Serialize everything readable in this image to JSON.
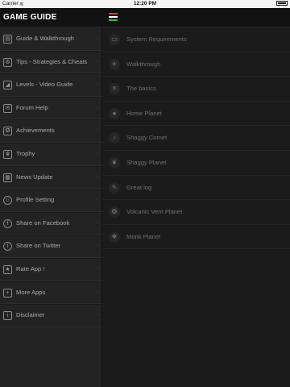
{
  "status_bar": {
    "carrier": "Carrier",
    "time": "12:20 PM"
  },
  "sidebar": {
    "title": "GAME GUIDE",
    "items": [
      {
        "label": "Guide & Walkthrough",
        "icon": "book-icon",
        "glyph": "▤"
      },
      {
        "label": "Tips - Strategies & Cheats",
        "icon": "chip-icon",
        "glyph": "⚙"
      },
      {
        "label": "Levels - Video Guide",
        "icon": "levels-icon",
        "glyph": "◢"
      },
      {
        "label": "Forum Help",
        "icon": "chat-icon",
        "glyph": "✉"
      },
      {
        "label": "Achievements",
        "icon": "medal-icon",
        "glyph": "✪"
      },
      {
        "label": "Trophy",
        "icon": "trophy-icon",
        "glyph": "♛"
      },
      {
        "label": "News Update",
        "icon": "news-icon",
        "glyph": "▦"
      },
      {
        "label": "Profile Setting",
        "icon": "user-icon",
        "glyph": "☺"
      },
      {
        "label": "Share on Facebook",
        "icon": "facebook-icon",
        "glyph": "f"
      },
      {
        "label": "Share on Twitter",
        "icon": "twitter-icon",
        "glyph": "t"
      },
      {
        "label": "Rate App !",
        "icon": "star-icon",
        "glyph": "★"
      },
      {
        "label": "More Apps",
        "icon": "plus-icon",
        "glyph": "+"
      },
      {
        "label": "Disclaimer",
        "icon": "info-icon",
        "glyph": "i"
      }
    ]
  },
  "main": {
    "menu_colors": [
      "#d93a2b",
      "#ffffff",
      "#3bb34a"
    ],
    "items": [
      {
        "label": "System Requirements",
        "icon": "monitor-icon",
        "glyph": "▭"
      },
      {
        "label": "Walkthrough",
        "icon": "walker-icon",
        "glyph": "✈"
      },
      {
        "label": "The basics",
        "icon": "shuffle-icon",
        "glyph": "✕"
      },
      {
        "label": "Home Planet",
        "icon": "planet-icon",
        "glyph": "●"
      },
      {
        "label": "Shaggy Comet",
        "icon": "guitar-icon",
        "glyph": "♪"
      },
      {
        "label": "Shaggy Planet",
        "icon": "leaf-icon",
        "glyph": "❦"
      },
      {
        "label": "Great log",
        "icon": "pen-icon",
        "glyph": "✎"
      },
      {
        "label": "Volcanic Vent Planet",
        "icon": "volcano-icon",
        "glyph": "❂"
      },
      {
        "label": "Monk Planet",
        "icon": "monk-icon",
        "glyph": "❖"
      }
    ]
  }
}
